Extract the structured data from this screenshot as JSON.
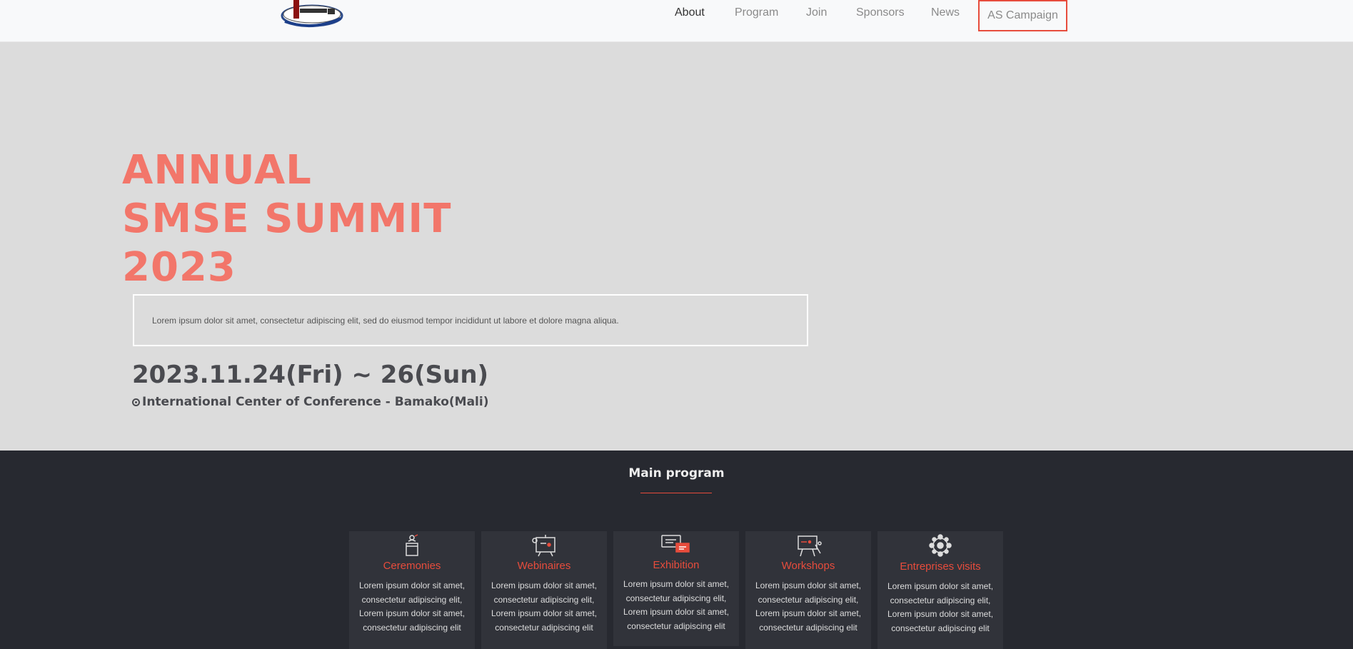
{
  "header": {
    "logo_alt": "Logo",
    "nav": [
      {
        "label": "About"
      },
      {
        "label": "Program"
      },
      {
        "label": "Join"
      },
      {
        "label": "Sponsors"
      },
      {
        "label": "News"
      }
    ],
    "campaign_label": "AS Campaign"
  },
  "hero": {
    "title_lines": [
      "ANNUAL",
      "SMSE SUMMIT",
      "2023"
    ],
    "description": "Lorem ipsum dolor sit amet, consectetur adipiscing elit, sed do eiusmod tempor incididunt ut labore et dolore magna aliqua.",
    "date": "2023.11.24(Fri) ~ 26(Sun)",
    "venue": "International Center of Conference - Bamako(Mali)"
  },
  "program": {
    "title": "Main program",
    "cards": [
      {
        "title": "Ceremonies",
        "icon": "podium-icon",
        "text": "Lorem ipsum dolor sit amet, consectetur adipiscing elit, Lorem ipsum dolor sit amet, consectetur adipiscing elit"
      },
      {
        "title": "Webinaires",
        "icon": "presentation-board-icon",
        "text": "Lorem ipsum dolor sit amet, consectetur adipiscing elit, Lorem ipsum dolor sit amet, consectetur adipiscing elit"
      },
      {
        "title": "Exhibition",
        "icon": "chat-bubbles-icon",
        "text": "Lorem ipsum dolor sit amet, consectetur adipiscing elit, Lorem ipsum dolor sit amet, consectetur adipiscing elit"
      },
      {
        "title": "Workshops",
        "icon": "easel-icon",
        "text": "Lorem ipsum dolor sit amet, consectetur adipiscing elit, Lorem ipsum dolor sit amet, consectetur adipiscing elit"
      },
      {
        "title": "Entreprises visits",
        "icon": "network-icon",
        "text": "Lorem ipsum dolor sit amet, consectetur adipiscing elit, Lorem ipsum dolor sit amet, consectetur adipiscing elit"
      }
    ]
  },
  "colors": {
    "accent": "#e74c3c",
    "hero_title": "#f2766a",
    "hero_bg": "#dcdcdc",
    "program_bg": "#272930",
    "card_bg": "#31333a"
  }
}
